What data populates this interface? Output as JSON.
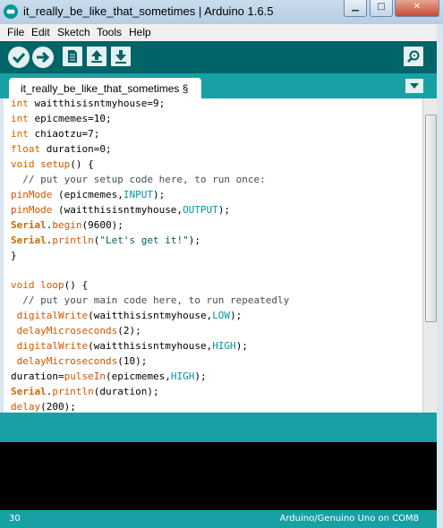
{
  "window": {
    "title": "it_really_be_like_that_sometimes | Arduino 1.6.5",
    "minimize_label": "▁",
    "maximize_label": "□",
    "close_label": "✕"
  },
  "menu": {
    "items": [
      "File",
      "Edit",
      "Sketch",
      "Tools",
      "Help"
    ]
  },
  "toolbar": {
    "icons": [
      "verify-icon",
      "upload-icon",
      "new-icon",
      "open-icon",
      "save-icon",
      "serial-monitor-icon"
    ]
  },
  "tabs": {
    "active": "it_really_be_like_that_sometimes §"
  },
  "code": {
    "lines": [
      "int waitthisisntmyhouse=9;",
      "int epicmemes=10;",
      "int chiaotzu=7;",
      "float duration=0;",
      "void setup() {",
      "  // put your setup code here, to run once:",
      "pinMode (epicmemes,INPUT);",
      "pinMode (waitthisisntmyhouse,OUTPUT);",
      "Serial.begin(9600);",
      "Serial.println(\"Let's get it!\");",
      "}",
      "",
      "void loop() {",
      "  // put your main code here, to run repeatedly",
      " digitalWrite(waitthisisntmyhouse,LOW);",
      " delayMicroseconds(2);",
      " digitalWrite(waitthisisntmyhouse,HIGH);",
      " delayMicroseconds(10);",
      "duration=pulseIn(epicmemes,HIGH);",
      "Serial.println(duration);",
      "delay(200);"
    ]
  },
  "status": {
    "line_number": "30",
    "board": "Arduino/Genuino Uno on COM8"
  },
  "colors": {
    "toolbar": "#006468",
    "tabbar": "#17a1a5",
    "keyword": "#cc6600",
    "constant": "#00979c"
  }
}
